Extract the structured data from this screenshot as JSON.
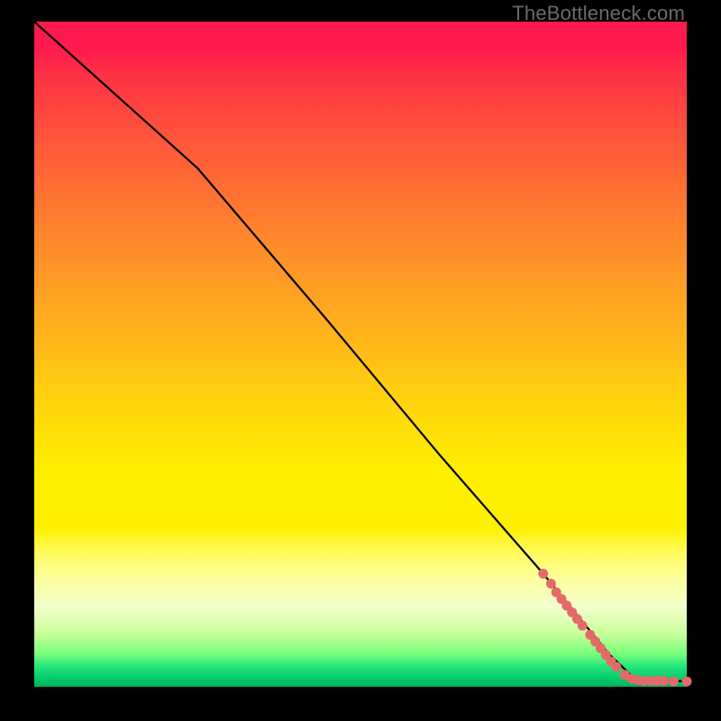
{
  "credit": "TheBottleneck.com",
  "chart_data": {
    "type": "line",
    "title": "",
    "xlabel": "",
    "ylabel": "",
    "xlim": [
      0,
      100
    ],
    "ylim": [
      0,
      100
    ],
    "colors": {
      "top": "#ff1a4d",
      "mid": "#fff000",
      "bottom": "#00b35c",
      "line": "#000000",
      "marker": "#e46a6a"
    },
    "line": {
      "name": "bottleneck-curve",
      "points": [
        {
          "x": 0,
          "y": 100
        },
        {
          "x": 25,
          "y": 78
        },
        {
          "x": 45,
          "y": 55
        },
        {
          "x": 62,
          "y": 35
        },
        {
          "x": 78,
          "y": 17
        },
        {
          "x": 88,
          "y": 5
        },
        {
          "x": 92,
          "y": 1.2
        },
        {
          "x": 100,
          "y": 0.8
        }
      ]
    },
    "markers": [
      {
        "x": 78.0,
        "y": 17.0
      },
      {
        "x": 79.2,
        "y": 15.5
      },
      {
        "x": 80.0,
        "y": 14.2
      },
      {
        "x": 80.8,
        "y": 13.2
      },
      {
        "x": 81.6,
        "y": 12.2
      },
      {
        "x": 82.4,
        "y": 11.2
      },
      {
        "x": 83.2,
        "y": 10.2
      },
      {
        "x": 84.0,
        "y": 9.2
      },
      {
        "x": 85.2,
        "y": 7.8
      },
      {
        "x": 86.0,
        "y": 6.8
      },
      {
        "x": 86.8,
        "y": 5.8
      },
      {
        "x": 87.6,
        "y": 4.8
      },
      {
        "x": 88.4,
        "y": 3.8
      },
      {
        "x": 89.2,
        "y": 3.0
      },
      {
        "x": 90.5,
        "y": 1.8
      },
      {
        "x": 91.5,
        "y": 1.2
      },
      {
        "x": 92.5,
        "y": 1.0
      },
      {
        "x": 93.5,
        "y": 0.9
      },
      {
        "x": 94.5,
        "y": 0.9
      },
      {
        "x": 95.5,
        "y": 0.9
      },
      {
        "x": 96.5,
        "y": 0.9
      },
      {
        "x": 98.0,
        "y": 0.8
      },
      {
        "x": 100.0,
        "y": 0.8
      }
    ]
  }
}
